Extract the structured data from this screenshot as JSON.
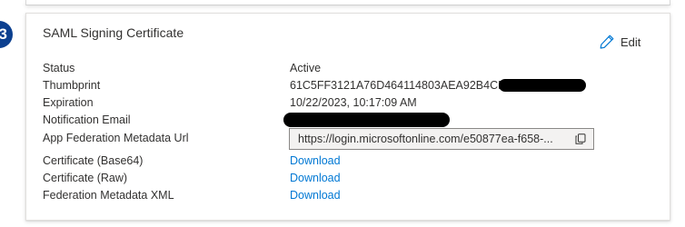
{
  "step": {
    "number": "3"
  },
  "card": {
    "title": "SAML Signing Certificate",
    "edit_label": "Edit"
  },
  "fields": [
    {
      "label": "Status",
      "value": "Active"
    },
    {
      "label": "Thumbprint",
      "value": "61C5FF3121A76D464114803AEA92B4CD"
    },
    {
      "label": "Expiration",
      "value": "10/22/2023, 10:17:09 AM"
    },
    {
      "label": "Notification Email",
      "value": ""
    },
    {
      "label": "App Federation Metadata Url",
      "value": "https://login.microsoftonline.com/e50877ea-f658-..."
    },
    {
      "label": "Certificate (Base64)",
      "value": "Download"
    },
    {
      "label": "Certificate (Raw)",
      "value": "Download"
    },
    {
      "label": "Federation Metadata XML",
      "value": "Download"
    }
  ],
  "colors": {
    "link": "#0078d4",
    "badge": "#0b3f8f",
    "text": "#323130"
  },
  "icons": {
    "edit": "pencil-icon",
    "copy": "copy-icon"
  }
}
